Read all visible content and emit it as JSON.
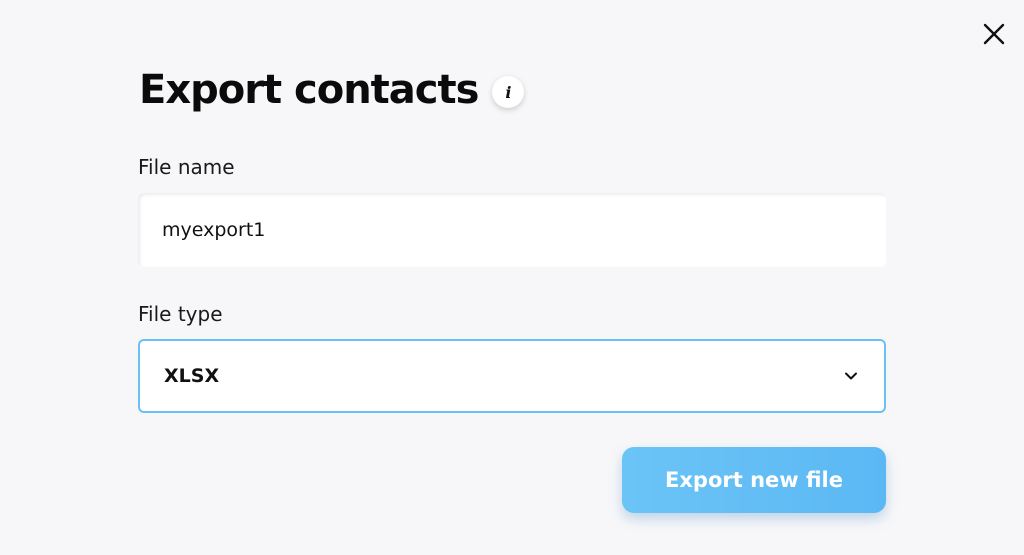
{
  "dialog": {
    "title": "Export contacts",
    "info_icon": "info-icon",
    "close_icon": "close-icon",
    "info_glyph": "i"
  },
  "form": {
    "file_name": {
      "label": "File name",
      "value": "myexport1"
    },
    "file_type": {
      "label": "File type",
      "selected": "XLSX",
      "icon": "chevron-down-icon"
    }
  },
  "actions": {
    "export_label": "Export new file"
  },
  "colors": {
    "background": "#f7f7f9",
    "accent": "#5cb8f4",
    "select_border": "#6cc0f2",
    "button_text": "#ffffff"
  }
}
